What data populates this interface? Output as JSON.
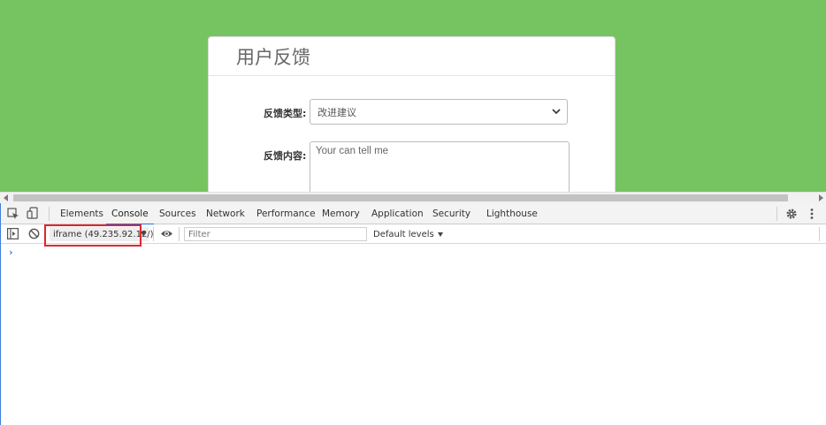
{
  "webpage": {
    "panel_title": "用户反馈",
    "feedback_type_label": "反馈类型:",
    "feedback_type_value": "改进建议",
    "feedback_content_label": "反馈内容:",
    "feedback_content_placeholder": "Your can tell me",
    "background_color": "#76c461"
  },
  "devtools": {
    "tabs": [
      "Elements",
      "Console",
      "Sources",
      "Network",
      "Performance",
      "Memory",
      "Application",
      "Security",
      "Lighthouse"
    ],
    "active_tab": "Console",
    "context_selector": "iframe (49.235.92.12/)",
    "filter_placeholder": "Filter",
    "levels_label": "Default levels",
    "prompt_symbol": "›",
    "icons": [
      "inspect-element-icon",
      "device-toolbar-icon",
      "settings-gear-icon",
      "more-vert-icon",
      "sidebar-toggle-icon",
      "clear-console-icon",
      "eye-icon"
    ],
    "accent_color": "#1a73e8",
    "highlight_color": "#e3242b"
  }
}
